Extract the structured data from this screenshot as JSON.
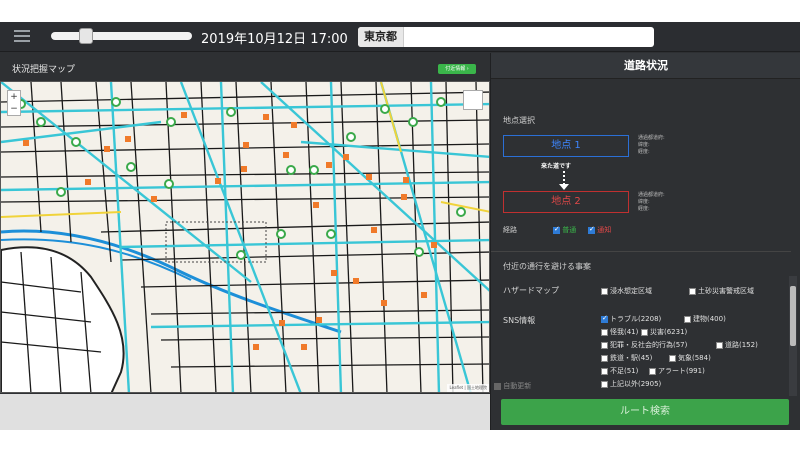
{
  "header": {
    "datetime": "2019年10月12日 17:00",
    "prefecture_label": "東京都",
    "prefecture_value": ""
  },
  "map": {
    "title": "状況把握マップ",
    "badge": "付近情報 ›",
    "zoom_in": "+",
    "zoom_out": "−",
    "attribution": "Leaflet | 国土地理院"
  },
  "right": {
    "title": "道路状況",
    "point_section": "地点選択",
    "point1": "地点 1",
    "point2": "地点 2",
    "point1_info": [
      "通過都道府:",
      "緯度:",
      "経度:"
    ],
    "point2_info": [
      "通過都道府:",
      "緯度:",
      "経度:"
    ],
    "arrow_note": "来た道です",
    "route_label": "経路",
    "route_options": [
      {
        "label": "普通",
        "color": "#3ab54a",
        "checked": true
      },
      {
        "label": "通知",
        "color": "#e04848",
        "checked": true
      }
    ],
    "avoid_section": "付近の通行を避ける事案",
    "hazard_label": "ハザードマップ",
    "hazard_options": [
      {
        "label": "浸水想定区域",
        "checked": false
      },
      {
        "label": "土砂災害警戒区域",
        "checked": false
      }
    ],
    "sns_label": "SNS情報",
    "sns_options": [
      {
        "label": "トラブル(2208)",
        "checked": true
      },
      {
        "label": "建物(400)",
        "checked": false
      },
      {
        "label": "怪我(41)",
        "checked": false
      },
      {
        "label": "災害(6231)",
        "checked": false
      },
      {
        "label": "犯罪・反社会的行為(57)",
        "checked": false
      },
      {
        "label": "道路(152)",
        "checked": false
      },
      {
        "label": "鉄道・駅(45)",
        "checked": false
      },
      {
        "label": "気象(584)",
        "checked": false
      },
      {
        "label": "不足(51)",
        "checked": false
      },
      {
        "label": "アラート(991)",
        "checked": false
      },
      {
        "label": "上記以外(2905)",
        "checked": false
      }
    ],
    "auto_update": "自動更新",
    "search_button": "ルート検索"
  }
}
